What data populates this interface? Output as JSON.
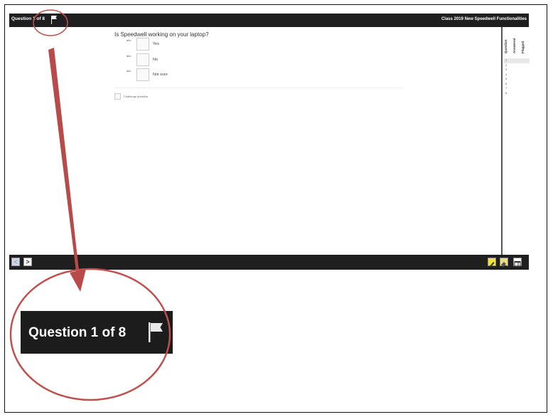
{
  "app": {
    "question_counter": "Question 1 of 8",
    "exam_title": "Class 2019 New Speedwell Functionalities"
  },
  "question": {
    "text": "Is Speedwell working on your laptop?",
    "options": [
      {
        "code": "abc",
        "label": "Yes"
      },
      {
        "code": "abc",
        "label": "No"
      },
      {
        "code": "abc",
        "label": "Not sure"
      }
    ],
    "challenge_label": "Challenge question"
  },
  "side_panel": {
    "headers": [
      "Question",
      "Answered",
      "Flagged"
    ],
    "questions": [
      "1",
      "2",
      "3",
      "4",
      "5",
      "6",
      "7",
      "8"
    ],
    "selected_index": 0
  },
  "navigation": {
    "prev_symbol": "<",
    "next_symbol": ">"
  },
  "tools": {
    "icons": [
      "highlighter-icon",
      "eraser-icon",
      "panel-toggle-icon"
    ]
  },
  "zoom_callout": {
    "question_counter": "Question 1 of 8",
    "annotation_color": "#c0504d",
    "arrow_color": "#b94a4a"
  }
}
